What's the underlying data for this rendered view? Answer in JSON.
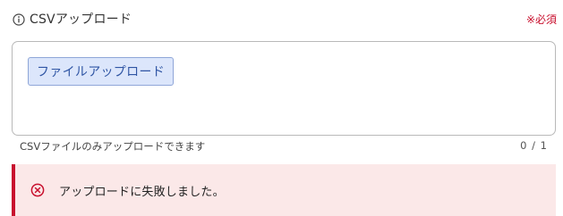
{
  "field": {
    "label": "CSVアップロード",
    "required_text": "※必須",
    "info_icon": "info-circle-icon"
  },
  "upload": {
    "button_label": "ファイルアップロード",
    "helper_text": "CSVファイルのみアップロードできます",
    "file_count": "0 / 1"
  },
  "alert": {
    "message": "アップロードに失敗しました。",
    "icon": "error-circle-x-icon"
  },
  "colors": {
    "required_red": "#c8102e",
    "button_bg": "#dce6fb",
    "button_border": "#8fa6d8",
    "button_text": "#2f55a4",
    "alert_bg": "#fbe8e8",
    "alert_accent": "#c8102e"
  }
}
